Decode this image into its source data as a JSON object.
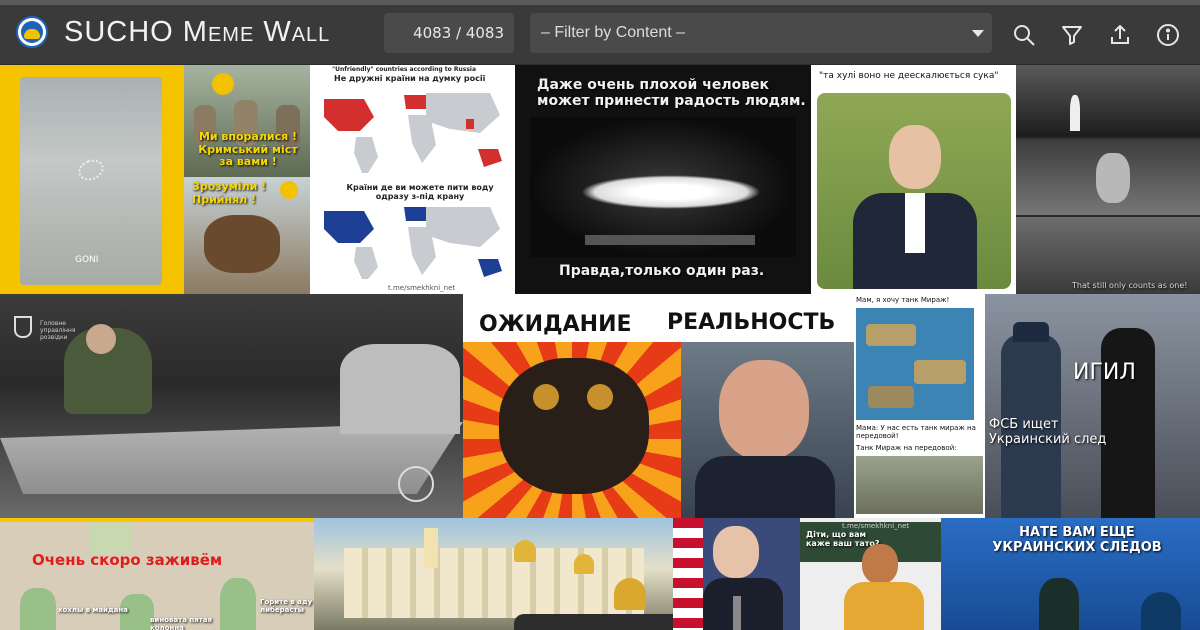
{
  "header": {
    "title": "SUCHO Meme Wall",
    "counter": "4083 / 4083",
    "filter_placeholder": "– Filter by Content –"
  },
  "tiles": {
    "t1": {
      "watermark": "GONI"
    },
    "t2": {
      "caption_top": "Ми впоралися ! Кримський міст за вами !",
      "caption_bottom": "Зрозуміли ! Прийнял !"
    },
    "t3": {
      "title_top": "\"Unfriendly\" countries according to Russia",
      "caption_top": "Не дружні країни на думку росії",
      "caption_bottom": "Країни де ви можете пити воду одразу з-під крану",
      "watermark": "t.me/smekhkni_net"
    },
    "t4": {
      "caption_top": "Даже очень плохой человек может принести радость людям.",
      "caption_bottom": "Правда,только один раз."
    },
    "t5": {
      "caption": "\"та хулі воно не деескалюється сука\""
    },
    "t6": {
      "caption": "That still only counts as one!"
    },
    "t7": {
      "watermark": "Головне управління розвідки"
    },
    "t8": {
      "label_left": "ОЖИДАНИЕ",
      "label_right": "РЕАЛЬНОСТЬ"
    },
    "t9": {
      "line1": "Мам, я хочу танк Мираж!",
      "line2": "Мама: У нас есть танк мираж на передовой!",
      "line3": "Танк Мираж на передовой:"
    },
    "t10": {
      "label1": "ИГИЛ",
      "label2": "ФСБ ищет Украинский след"
    },
    "t11": {
      "caption": "Очень скоро заживём",
      "sub1": "Горите в аду либерасты",
      "sub2": "хохлы в майдана",
      "sub3": "виновата пятая колонна"
    },
    "t14": {
      "caption": "Діти, що вам каже ваш тато?",
      "watermark": "t.me/smekhkni_net"
    },
    "t15": {
      "caption": "НАТЕ ВАМ ЕЩЕ УКРАИНСКИХ СЛЕДОВ"
    }
  }
}
